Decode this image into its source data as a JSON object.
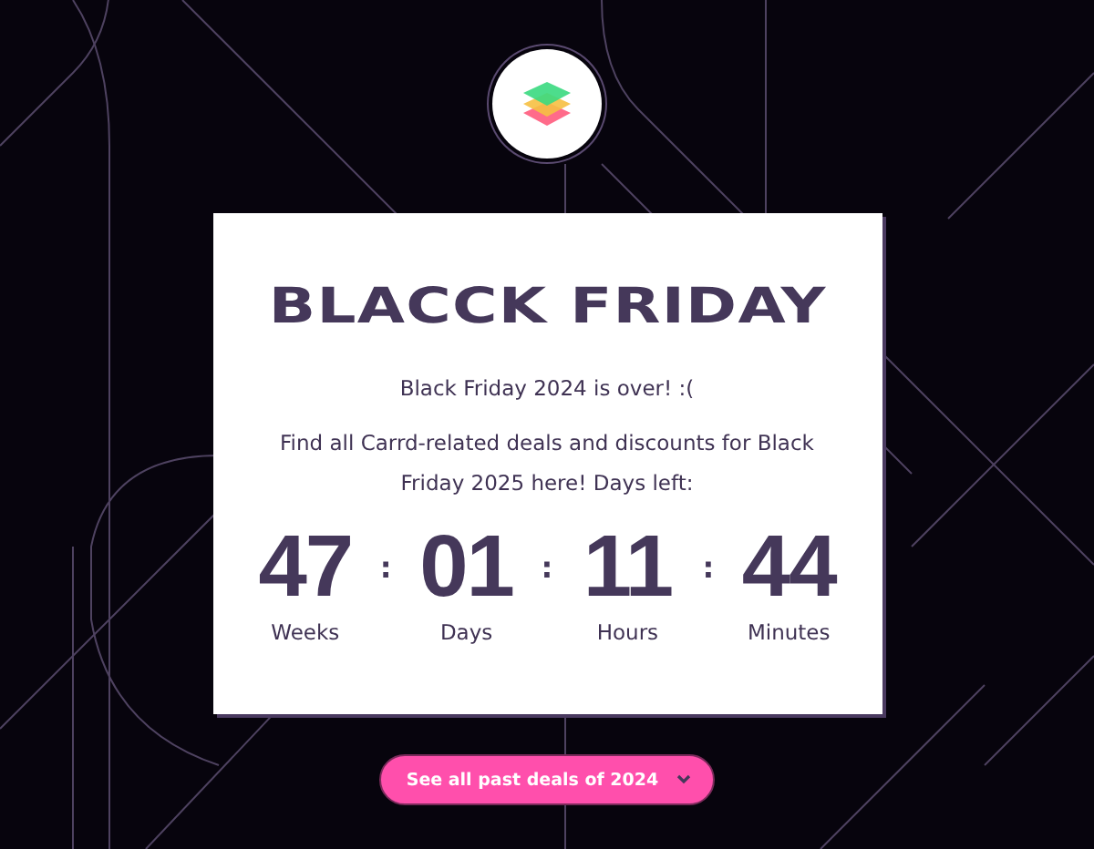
{
  "title": "BLACCK FRIDAY",
  "intro": "Black Friday 2024 is over! :(",
  "message": "Find all Carrd-related deals and discounts for Black Friday 2025 here! Days left:",
  "countdown": [
    {
      "value": "47",
      "unit": "Weeks"
    },
    {
      "value": "01",
      "unit": "Days"
    },
    {
      "value": "11",
      "unit": "Hours"
    },
    {
      "value": "44",
      "unit": "Minutes"
    }
  ],
  "separator": ":",
  "button": {
    "label": "See all past deals of 2024"
  }
}
